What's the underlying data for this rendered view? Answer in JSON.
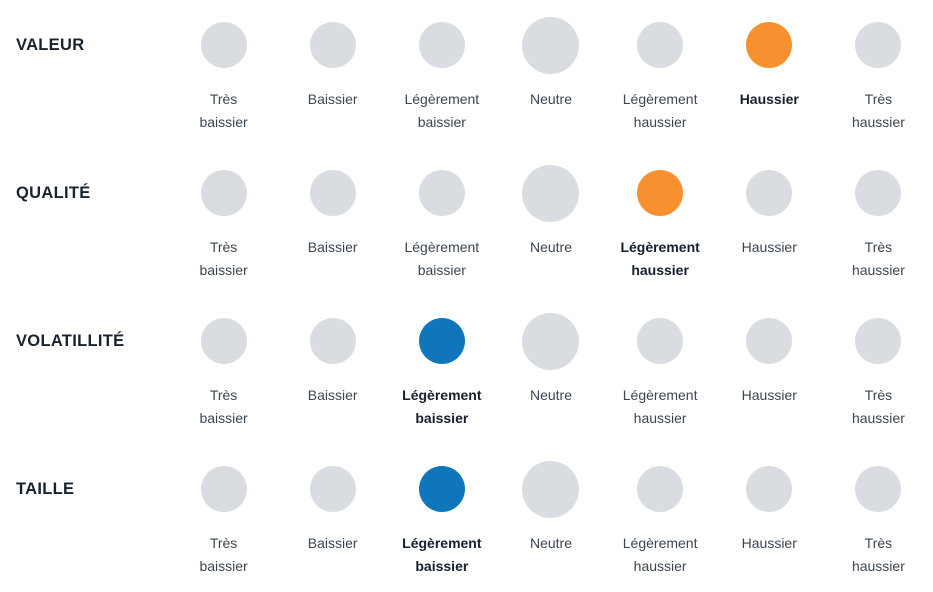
{
  "colors": {
    "inactive": "#D9DCE1",
    "orange": "#F7902E",
    "blue": "#0F76BC",
    "row_label_text": "#18232F",
    "option_text": "#3C4653",
    "active_option_text": "#16202C",
    "background": "#FFFFFF"
  },
  "scale_labels": [
    "Très\nbaissier",
    "Baissier",
    "Légèrement\nbaissier",
    "Neutre",
    "Légèrement\nhaussier",
    "Haussier",
    "Très\nhaussier"
  ],
  "rows": [
    {
      "label": "VALEUR",
      "selected_index": 5,
      "selected_label": "Haussier",
      "selected_color": "orange"
    },
    {
      "label": "QUALITÉ",
      "selected_index": 4,
      "selected_label": "Légèrement haussier",
      "selected_color": "orange"
    },
    {
      "label": "VOLATILLITÉ",
      "selected_index": 2,
      "selected_label": "Légèrement baissier",
      "selected_color": "blue"
    },
    {
      "label": "TAILLE",
      "selected_index": 2,
      "selected_label": "Légèrement baissier",
      "selected_color": "blue"
    }
  ],
  "chart_data": {
    "type": "heatmap",
    "title": "",
    "xlabel": "",
    "ylabel": "",
    "categories": [
      "Très baissier",
      "Baissier",
      "Légèrement baissier",
      "Neutre",
      "Légèrement haussier",
      "Haussier",
      "Très haussier"
    ],
    "category_scores": [
      -3,
      -2,
      -1,
      0,
      1,
      2,
      3
    ],
    "series": [
      {
        "name": "VALEUR",
        "selected_index": 5,
        "value": 2,
        "selected_label": "Haussier",
        "marker_color": "#F7902E"
      },
      {
        "name": "QUALITÉ",
        "selected_index": 4,
        "value": 1,
        "selected_label": "Légèrement haussier",
        "marker_color": "#F7902E"
      },
      {
        "name": "VOLATILLITÉ",
        "selected_index": 2,
        "value": -1,
        "selected_label": "Légèrement baissier",
        "marker_color": "#0F76BC"
      },
      {
        "name": "TAILLE",
        "selected_index": 2,
        "value": -1,
        "selected_label": "Légèrement baissier",
        "marker_color": "#0F76BC"
      }
    ],
    "xlim": [
      -3,
      3
    ],
    "grid": false,
    "legend": "none",
    "notes": "Each row is a factor; a single filled circle marks the selected position on a 7-point bearish-to-bullish scale. The centre 'Neutre' marker is drawn larger than the others."
  }
}
